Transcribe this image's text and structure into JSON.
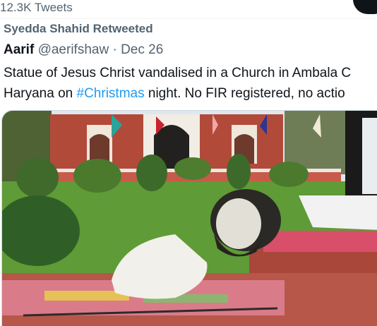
{
  "header": {
    "tweet_count": "12.3K Tweets"
  },
  "retweet": {
    "text": "Syedda Shahid Retweeted"
  },
  "tweet": {
    "author_name": "Aarif",
    "handle": "@aerifshaw",
    "separator": "·",
    "date": "Dec 26",
    "text_line1": "Statue of Jesus Christ vandalised in a Church in Ambala C",
    "text_line2_before": "Haryana  on ",
    "hashtag": "#Christmas",
    "text_line2_after": " night. No FIR registered, no actio"
  },
  "media": {
    "icon": "photo"
  },
  "colors": {
    "hashtag": "#1d9bf0",
    "muted": "#536471",
    "text": "#0f1419"
  }
}
